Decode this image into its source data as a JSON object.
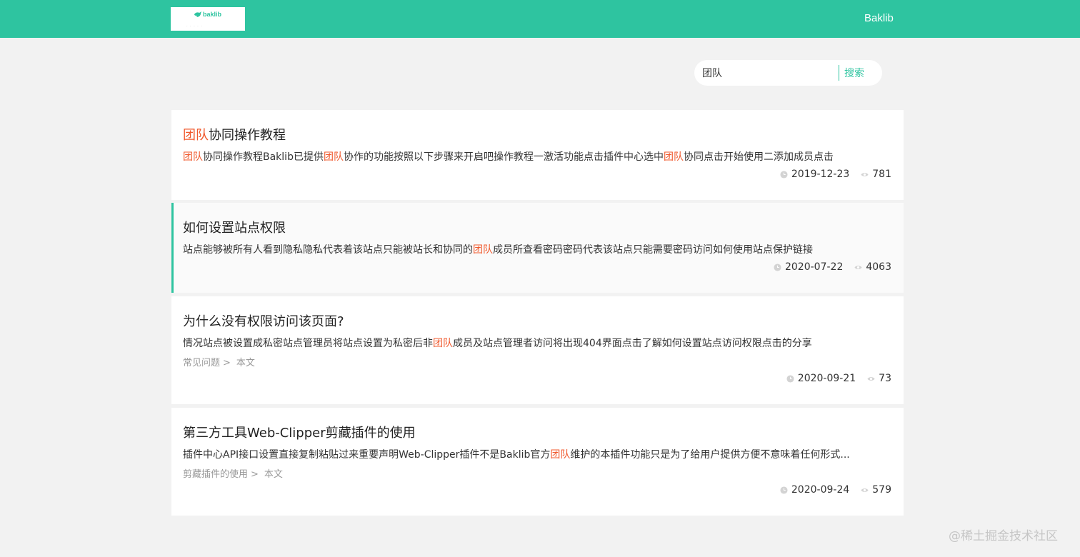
{
  "header": {
    "logo_text": "baklib",
    "logo_subtext": "· · · · ·",
    "brand_link": "Baklib"
  },
  "search": {
    "value": "团队",
    "button_label": "搜索"
  },
  "highlight_color": "#f0582c",
  "accent_color": "#2ec4a0",
  "icons": {
    "date": "clock-icon",
    "views": "eye-icon"
  },
  "results": [
    {
      "title_parts": [
        {
          "t": "团队",
          "hl": true
        },
        {
          "t": "协同操作教程",
          "hl": false
        }
      ],
      "snippet_parts": [
        {
          "t": "团队",
          "hl": true
        },
        {
          "t": "协同操作教程Baklib已提供",
          "hl": false
        },
        {
          "t": "团队",
          "hl": true
        },
        {
          "t": "协作的功能按照以下步骤来开启吧操作教程一激活功能点击插件中心选中",
          "hl": false
        },
        {
          "t": "团队",
          "hl": true
        },
        {
          "t": "协同点击开始使用二添加成员点击",
          "hl": false
        }
      ],
      "breadcrumb": null,
      "date": "2019-12-23",
      "views": "781"
    },
    {
      "title_parts": [
        {
          "t": "如何设置站点权限",
          "hl": false
        }
      ],
      "snippet_parts": [
        {
          "t": "站点能够被所有人看到隐私隐私代表着该站点只能被站长和协同的",
          "hl": false
        },
        {
          "t": "团队",
          "hl": true
        },
        {
          "t": "成员所查看密码密码代表该站点只能需要密码访问如何使用站点保护链接",
          "hl": false
        }
      ],
      "breadcrumb": null,
      "date": "2020-07-22",
      "views": "4063"
    },
    {
      "title_parts": [
        {
          "t": "为什么没有权限访问该页面?",
          "hl": false
        }
      ],
      "snippet_parts": [
        {
          "t": "情况站点被设置成私密站点管理员将站点设置为私密后非",
          "hl": false
        },
        {
          "t": "团队",
          "hl": true
        },
        {
          "t": "成员及站点管理者访问将出现404界面点击了解如何设置站点访问权限点击的分享",
          "hl": false
        }
      ],
      "breadcrumb": {
        "parent": "常见问题",
        "sep": ">",
        "current": "本文"
      },
      "date": "2020-09-21",
      "views": "73"
    },
    {
      "title_parts": [
        {
          "t": "第三方工具Web-Clipper剪藏插件的使用",
          "hl": false
        }
      ],
      "snippet_parts": [
        {
          "t": "插件中心API接口设置直接复制粘贴过来重要声明Web-Clipper插件不是Baklib官方",
          "hl": false
        },
        {
          "t": "团队",
          "hl": true
        },
        {
          "t": "维护的本插件功能只是为了给用户提供方便不意味着任何形式...",
          "hl": false
        }
      ],
      "breadcrumb": {
        "parent": "剪藏插件的使用",
        "sep": ">",
        "current": "本文"
      },
      "date": "2020-09-24",
      "views": "579"
    }
  ],
  "watermark": "@稀土掘金技术社区"
}
